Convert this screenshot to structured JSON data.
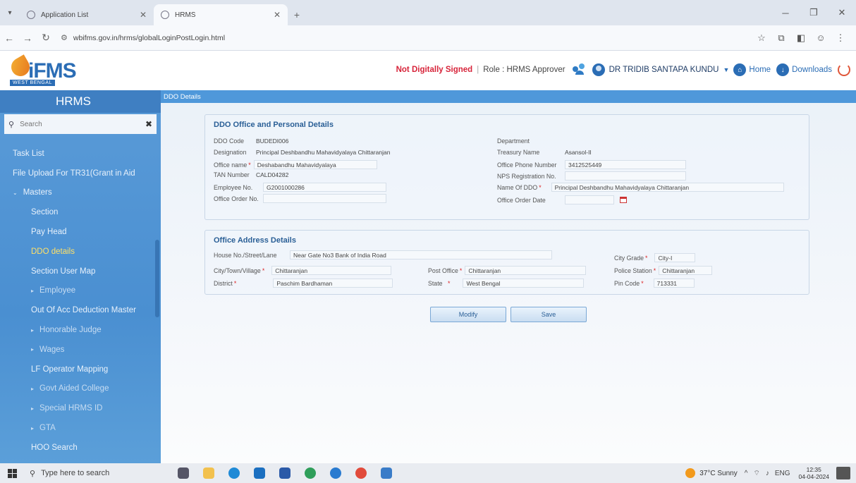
{
  "browser": {
    "tabs": [
      {
        "title": "Application List",
        "active": false
      },
      {
        "title": "HRMS",
        "active": true
      }
    ],
    "url": "wbifms.gov.in/hrms/globalLoginPostLogin.html"
  },
  "header": {
    "logo_text": "iFMS",
    "logo_sub": "WEST BENGAL",
    "signature_status": "Not Digitally Signed",
    "role_label": "Role :",
    "role_value": "HRMS Approver",
    "user_name": "DR TRIDIB SANTAPA KUNDU",
    "home_label": "Home",
    "downloads_label": "Downloads"
  },
  "sidebar": {
    "title": "HRMS",
    "search_placeholder": "Search",
    "items": [
      {
        "label": "Task List",
        "level": 0
      },
      {
        "label": "File Upload For TR31(Grant in Aid",
        "level": 0
      },
      {
        "label": "Masters",
        "level": 0
      },
      {
        "label": "Section",
        "level": 1
      },
      {
        "label": "Pay Head",
        "level": 1
      },
      {
        "label": "DDO details",
        "level": 1,
        "active": true
      },
      {
        "label": "Section User Map",
        "level": 1
      },
      {
        "label": "Employee",
        "level": 2
      },
      {
        "label": "Out Of Acc Deduction Master",
        "level": 1
      },
      {
        "label": "Honorable Judge",
        "level": 2
      },
      {
        "label": "Wages",
        "level": 2
      },
      {
        "label": "LF Operator Mapping",
        "level": 1
      },
      {
        "label": "Govt Aided College",
        "level": 2
      },
      {
        "label": "Special HRMS ID",
        "level": 2
      },
      {
        "label": "GTA",
        "level": 2
      },
      {
        "label": "HOO Search",
        "level": 1
      }
    ]
  },
  "main": {
    "breadcrumb": "DDO Details",
    "personal": {
      "title": "DDO Office and Personal Details",
      "ddo_code_label": "DDO Code",
      "ddo_code": "BUDEDI006",
      "department_label": "Department",
      "designation_label": "Designation",
      "designation": "Principal Deshbandhu Mahavidyalaya Chittaranjan",
      "treasury_label": "Treasury Name",
      "treasury": "Asansol-II",
      "office_name_label": "Office name",
      "office_name": "Deshabandhu Mahavidyalaya",
      "office_phone_label": "Office Phone Number",
      "office_phone": "3412525449",
      "tan_label": "TAN Number",
      "tan": "CALD04282",
      "nps_label": "NPS Registration No.",
      "nps": "",
      "employee_no_label": "Employee No.",
      "employee_no": "G2001000286",
      "name_of_ddo_label": "Name Of DDO",
      "name_of_ddo": "Principal Deshbandhu Mahavidyalaya Chittaranjan",
      "office_order_no_label": "Office Order No.",
      "office_order_no": "",
      "office_order_date_label": "Office Order Date",
      "office_order_date": ""
    },
    "address": {
      "title": "Office Address Details",
      "house_label": "House No./Street/Lane",
      "house": "Near Gate No3 Bank of India Road",
      "city_grade_label": "City Grade",
      "city_grade": "City-I",
      "city_label": "City/Town/Village",
      "city": "Chittaranjan",
      "post_office_label": "Post Office",
      "post_office": "Chittaranjan",
      "police_station_label": "Police Station",
      "police_station": "Chittaranjan",
      "district_label": "District",
      "district": "Paschim Bardhaman",
      "state_label": "State",
      "state": "West Bengal",
      "pin_label": "Pin Code",
      "pin": "713331"
    },
    "buttons": {
      "modify": "Modify",
      "save": "Save"
    }
  },
  "taskbar": {
    "search_placeholder": "Type here to search",
    "weather": "37°C Sunny",
    "lang": "ENG",
    "time": "12:35",
    "date": "04-04-2024"
  }
}
